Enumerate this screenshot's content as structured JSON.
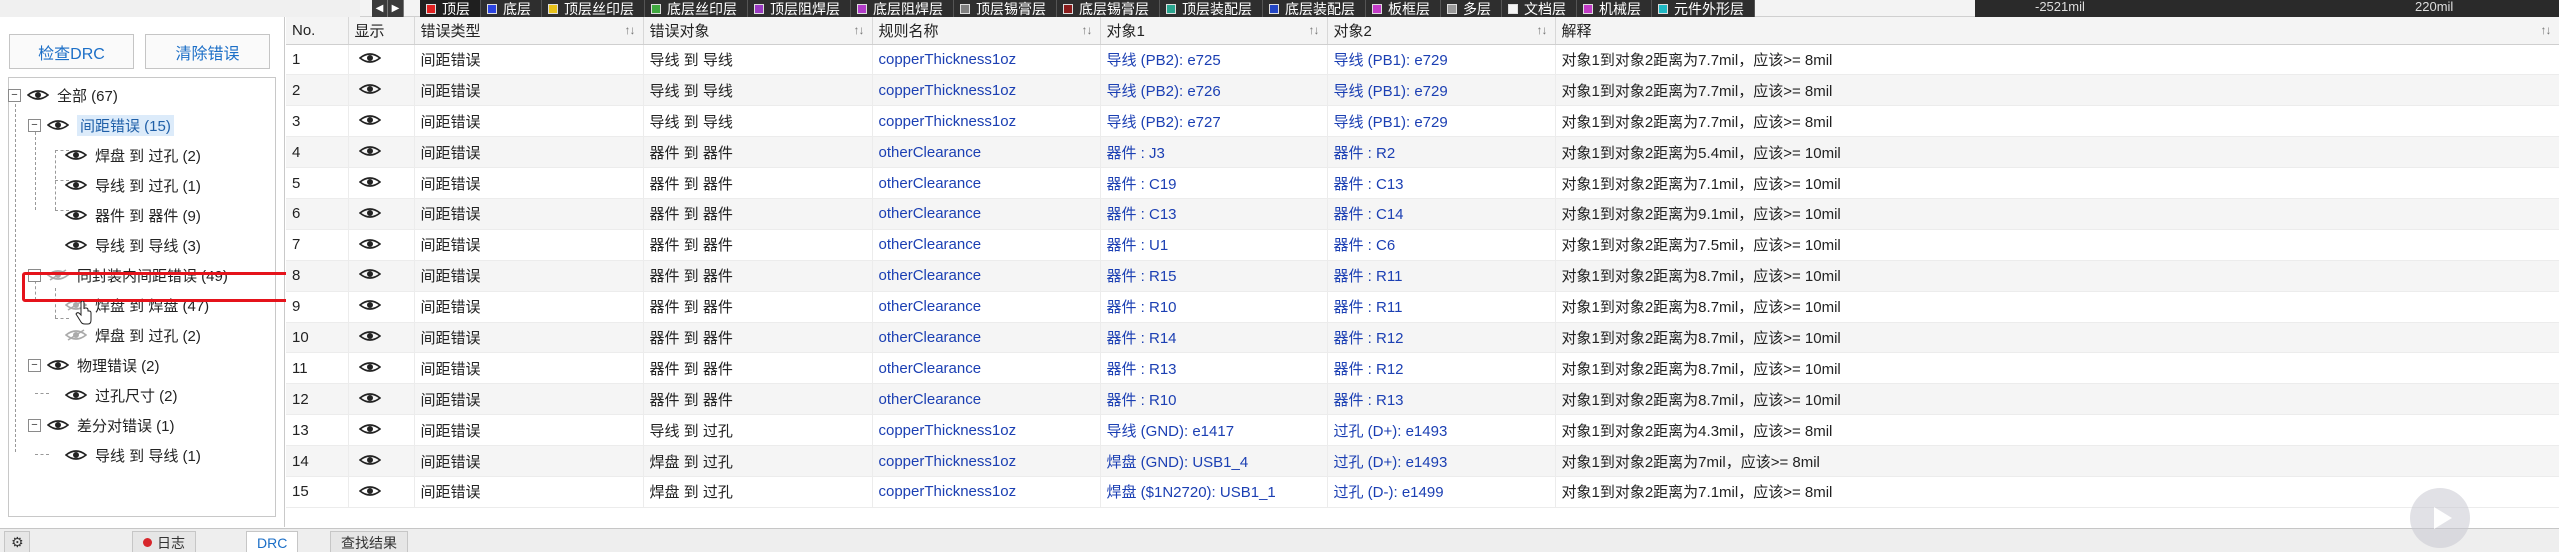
{
  "layerbar": {
    "nav_prev": "◀",
    "nav_next": "▶",
    "layers": [
      {
        "label": "顶层",
        "color": "#e02020",
        "active": true
      },
      {
        "label": "底层",
        "color": "#2b43e0"
      },
      {
        "label": "顶层丝印层",
        "color": "#e8c21a"
      },
      {
        "label": "底层丝印层",
        "color": "#3fa83f"
      },
      {
        "label": "顶层阻焊层",
        "color": "#9b3bc2"
      },
      {
        "label": "底层阻焊层",
        "color": "#b23cc9"
      },
      {
        "label": "顶层锡膏层",
        "color": "#808080"
      },
      {
        "label": "底层锡膏层",
        "color": "#8a1c1c"
      },
      {
        "label": "顶层装配层",
        "color": "#2aa58f"
      },
      {
        "label": "底层装配层",
        "color": "#2346c4"
      },
      {
        "label": "板框层",
        "color": "#c43cc8"
      },
      {
        "label": "多层",
        "color": "#9a9a9a"
      },
      {
        "label": "文档层",
        "color": "#f4f4f4"
      },
      {
        "label": "机械层",
        "color": "#c23cc6"
      },
      {
        "label": "元件外形层",
        "color": "#1fb8c4"
      }
    ],
    "coord_x": "-2521mil",
    "coord_y": "220mil"
  },
  "left": {
    "check_drc": "检查DRC",
    "clear_errors": "清除错误",
    "tree": {
      "all": "全部 (67)",
      "spacing": "间距错误 (15)",
      "pad_via": "焊盘 到 过孔 (2)",
      "track_via": "导线 到 过孔 (1)",
      "comp_comp": "器件 到 器件 (9)",
      "track_track": "导线 到 导线 (3)",
      "same_pkg": "同封装内间距错误 (49)",
      "pad_pad": "焊盘 到 焊盘 (47)",
      "pad_via2": "焊盘 到 过孔 (2)",
      "physical": "物理错误 (2)",
      "via_size": "过孔尺寸 (2)",
      "diff_pair": "差分对错误 (1)",
      "track_track2": "导线 到 导线 (1)"
    }
  },
  "table": {
    "headers": {
      "no": "No.",
      "show": "显示",
      "type": "错误类型",
      "objects": "错误对象",
      "rule": "规则名称",
      "obj1": "对象1",
      "obj2": "对象2",
      "desc": "解释"
    },
    "rows": [
      {
        "no": "1",
        "type": "间距错误",
        "objects": "导线 到 导线",
        "rule": "copperThickness1oz",
        "obj1": "导线 (PB2): e725",
        "obj2": "导线 (PB1): e729",
        "desc": "对象1到对象2距离为7.7mil，应该>= 8mil"
      },
      {
        "no": "2",
        "type": "间距错误",
        "objects": "导线 到 导线",
        "rule": "copperThickness1oz",
        "obj1": "导线 (PB2): e726",
        "obj2": "导线 (PB1): e729",
        "desc": "对象1到对象2距离为7.7mil，应该>= 8mil"
      },
      {
        "no": "3",
        "type": "间距错误",
        "objects": "导线 到 导线",
        "rule": "copperThickness1oz",
        "obj1": "导线 (PB2): e727",
        "obj2": "导线 (PB1): e729",
        "desc": "对象1到对象2距离为7.7mil，应该>= 8mil"
      },
      {
        "no": "4",
        "type": "间距错误",
        "objects": "器件 到 器件",
        "rule": "otherClearance",
        "obj1": "器件 : J3",
        "obj2": "器件 : R2",
        "desc": "对象1到对象2距离为5.4mil，应该>= 10mil"
      },
      {
        "no": "5",
        "type": "间距错误",
        "objects": "器件 到 器件",
        "rule": "otherClearance",
        "obj1": "器件 : C19",
        "obj2": "器件 : C13",
        "desc": "对象1到对象2距离为7.1mil，应该>= 10mil"
      },
      {
        "no": "6",
        "type": "间距错误",
        "objects": "器件 到 器件",
        "rule": "otherClearance",
        "obj1": "器件 : C13",
        "obj2": "器件 : C14",
        "desc": "对象1到对象2距离为9.1mil，应该>= 10mil"
      },
      {
        "no": "7",
        "type": "间距错误",
        "objects": "器件 到 器件",
        "rule": "otherClearance",
        "obj1": "器件 : U1",
        "obj2": "器件 : C6",
        "desc": "对象1到对象2距离为7.5mil，应该>= 10mil"
      },
      {
        "no": "8",
        "type": "间距错误",
        "objects": "器件 到 器件",
        "rule": "otherClearance",
        "obj1": "器件 : R15",
        "obj2": "器件 : R11",
        "desc": "对象1到对象2距离为8.7mil，应该>= 10mil"
      },
      {
        "no": "9",
        "type": "间距错误",
        "objects": "器件 到 器件",
        "rule": "otherClearance",
        "obj1": "器件 : R10",
        "obj2": "器件 : R11",
        "desc": "对象1到对象2距离为8.7mil，应该>= 10mil"
      },
      {
        "no": "10",
        "type": "间距错误",
        "objects": "器件 到 器件",
        "rule": "otherClearance",
        "obj1": "器件 : R14",
        "obj2": "器件 : R12",
        "desc": "对象1到对象2距离为8.7mil，应该>= 10mil"
      },
      {
        "no": "11",
        "type": "间距错误",
        "objects": "器件 到 器件",
        "rule": "otherClearance",
        "obj1": "器件 : R13",
        "obj2": "器件 : R12",
        "desc": "对象1到对象2距离为8.7mil，应该>= 10mil"
      },
      {
        "no": "12",
        "type": "间距错误",
        "objects": "器件 到 器件",
        "rule": "otherClearance",
        "obj1": "器件 : R10",
        "obj2": "器件 : R13",
        "desc": "对象1到对象2距离为8.7mil，应该>= 10mil"
      },
      {
        "no": "13",
        "type": "间距错误",
        "objects": "导线 到 过孔",
        "rule": "copperThickness1oz",
        "obj1": "导线 (GND): e1417",
        "obj2": "过孔 (D+): e1493",
        "desc": "对象1到对象2距离为4.3mil，应该>= 8mil"
      },
      {
        "no": "14",
        "type": "间距错误",
        "objects": "焊盘 到 过孔",
        "rule": "copperThickness1oz",
        "obj1": "焊盘 (GND): USB1_4",
        "obj2": "过孔 (D+): e1493",
        "desc": "对象1到对象2距离为7mil，应该>= 8mil"
      },
      {
        "no": "15",
        "type": "间距错误",
        "objects": "焊盘 到 过孔",
        "rule": "copperThickness1oz",
        "obj1": "焊盘 ($1N2720): USB1_1",
        "obj2": "过孔 (D-): e1499",
        "desc": "对象1到对象2距离为7.1mil，应该>= 8mil"
      }
    ]
  },
  "bottom": {
    "tab_log": "日志",
    "tab_drc": "DRC",
    "tab_find": "查找结果"
  }
}
